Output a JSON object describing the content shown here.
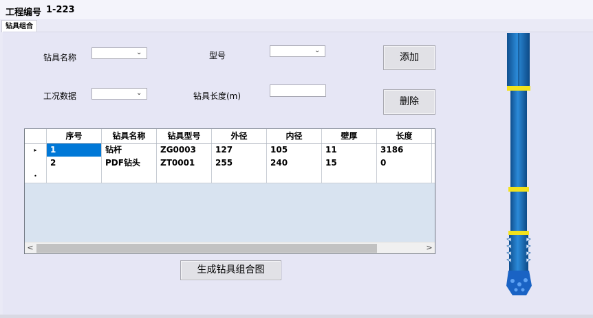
{
  "header": {
    "label": "工程编号",
    "value": "1-223"
  },
  "tabs": [
    {
      "label": "钻具组合"
    }
  ],
  "form": {
    "tool_name_label": "钻具名称",
    "model_label": "型号",
    "condition_label": "工况数据",
    "length_label": "钻具长度(m)",
    "tool_name_value": "",
    "model_value": "",
    "condition_value": "",
    "length_value": ""
  },
  "buttons": {
    "add": "添加",
    "delete": "删除",
    "generate": "生成钻具组合图"
  },
  "grid": {
    "columns": [
      "序号",
      "钻具名称",
      "钻具型号",
      "外径",
      "内径",
      "壁厚",
      "长度"
    ],
    "rows": [
      [
        "1",
        "钻杆",
        "ZG0003",
        "127",
        "105",
        "11",
        "3186"
      ],
      [
        "2",
        "PDF钻头",
        "ZT0001",
        "255",
        "240",
        "15",
        "0"
      ]
    ],
    "current_row_marker": "▸",
    "new_row_marker": "•",
    "scroll_left": "<",
    "scroll_right": ">"
  },
  "icons": {
    "dropdown": "chevron-down-icon",
    "tool_string": "drill-string-diagram"
  },
  "colors": {
    "selection": "#0078d7",
    "pipe": "#1f74c0",
    "collar": "#f2e21c"
  }
}
